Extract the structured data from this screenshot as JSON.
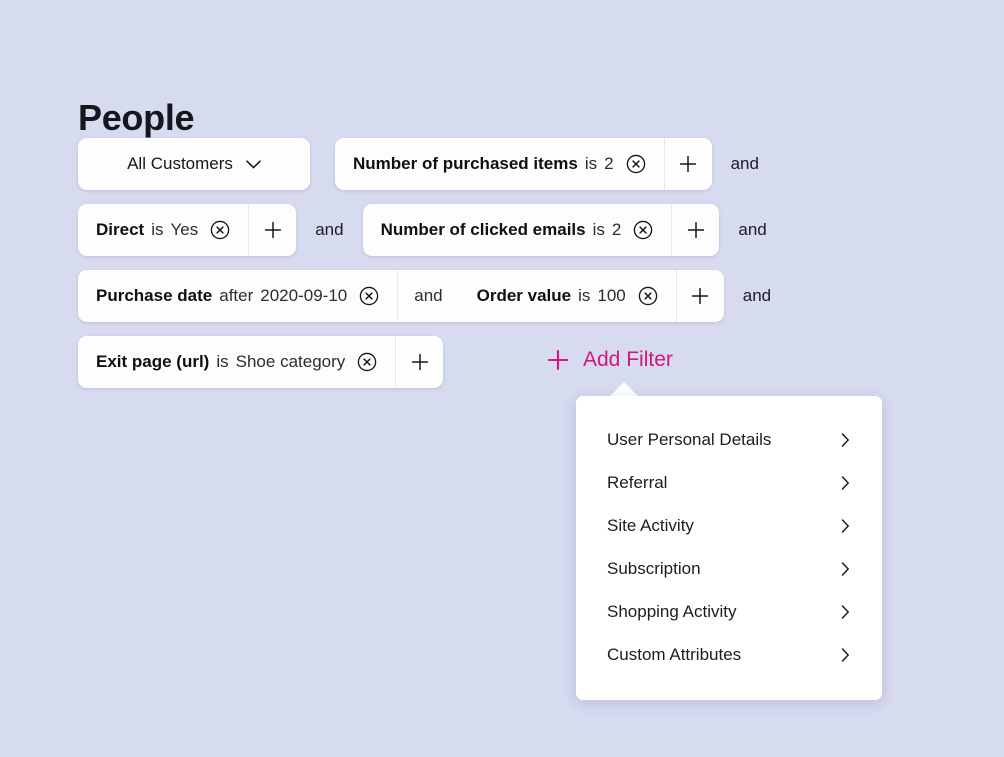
{
  "page": {
    "title": "People",
    "background_color": "#d7dbf0"
  },
  "audience_select": {
    "label": "All Customers",
    "icon": "chevron-down-icon"
  },
  "conjunction_label": "and",
  "icons": {
    "remove": "remove-circle-x-icon",
    "add": "plus-icon",
    "submenu": "chevron-right-icon"
  },
  "filter_rows": [
    {
      "id": "row-1",
      "leading_select": true,
      "groups": [
        {
          "conditions": [
            {
              "attribute": "Number of purchased items",
              "operator": "is",
              "value": "2"
            }
          ],
          "has_add_button": true
        }
      ],
      "trailing_conjunction": "and"
    },
    {
      "id": "row-2",
      "leading_select": false,
      "groups": [
        {
          "conditions": [
            {
              "attribute": "Direct",
              "operator": "is",
              "value": "Yes"
            }
          ],
          "has_add_button": true
        },
        {
          "conditions": [
            {
              "attribute": "Number of clicked emails",
              "operator": "is",
              "value": "2"
            }
          ],
          "has_add_button": true
        }
      ],
      "between_conjunction": "and",
      "trailing_conjunction": "and"
    },
    {
      "id": "row-3",
      "leading_select": false,
      "groups": [
        {
          "conditions": [
            {
              "attribute": "Purchase date",
              "operator": "after",
              "value": "2020-09-10"
            },
            {
              "attribute": "Order value",
              "operator": "is",
              "value": "100"
            }
          ],
          "inner_conjunction": "and",
          "has_add_button": true
        }
      ],
      "trailing_conjunction": "and"
    },
    {
      "id": "row-4",
      "leading_select": false,
      "groups": [
        {
          "conditions": [
            {
              "attribute": "Exit page (url)",
              "operator": "is",
              "value": "Shoe category"
            }
          ],
          "has_add_button": true
        }
      ],
      "trailing_conjunction": ""
    }
  ],
  "add_filter": {
    "label": "Add Filter",
    "icon": "plus-icon",
    "color": "#d4177b"
  },
  "filter_menu": {
    "open": true,
    "items": [
      {
        "label": "User Personal Details",
        "has_submenu": true
      },
      {
        "label": "Referral",
        "has_submenu": true
      },
      {
        "label": "Site Activity",
        "has_submenu": true
      },
      {
        "label": "Subscription",
        "has_submenu": true
      },
      {
        "label": "Shopping Activity",
        "has_submenu": true
      },
      {
        "label": "Custom Attributes",
        "has_submenu": true
      }
    ]
  }
}
